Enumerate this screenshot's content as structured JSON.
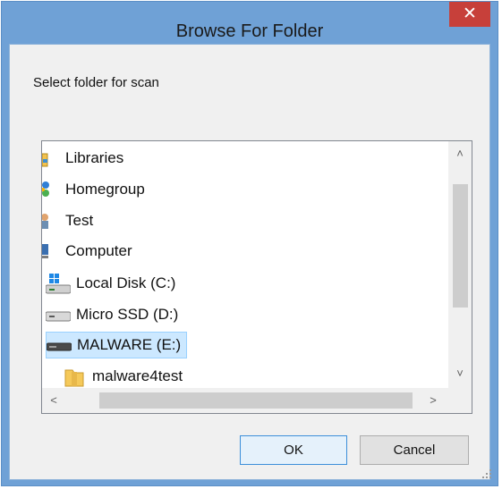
{
  "window": {
    "title": "Browse For Folder",
    "close_glyph": "✕"
  },
  "dialog": {
    "instruction": "Select folder for scan"
  },
  "tree": {
    "items": [
      {
        "label": "Libraries",
        "icon": "libraries-icon"
      },
      {
        "label": "Homegroup",
        "icon": "homegroup-icon"
      },
      {
        "label": "Test",
        "icon": "user-icon"
      },
      {
        "label": "Computer",
        "icon": "computer-icon"
      },
      {
        "label": "Local Disk (C:)",
        "icon": "windows-drive-icon"
      },
      {
        "label": "Micro SSD (D:)",
        "icon": "drive-icon"
      },
      {
        "label": "MALWARE (E:)",
        "icon": "usb-drive-icon",
        "selected": true
      },
      {
        "label": "malware4test",
        "icon": "folder-icon"
      }
    ],
    "scroll_up_glyph": "˄",
    "scroll_down_glyph": "˅",
    "scroll_left_glyph": "<",
    "scroll_right_glyph": ">"
  },
  "buttons": {
    "ok": "OK",
    "cancel": "Cancel"
  },
  "colors": {
    "frame": "#6fa1d6",
    "close": "#c7403a",
    "selection": "#cce8ff"
  }
}
